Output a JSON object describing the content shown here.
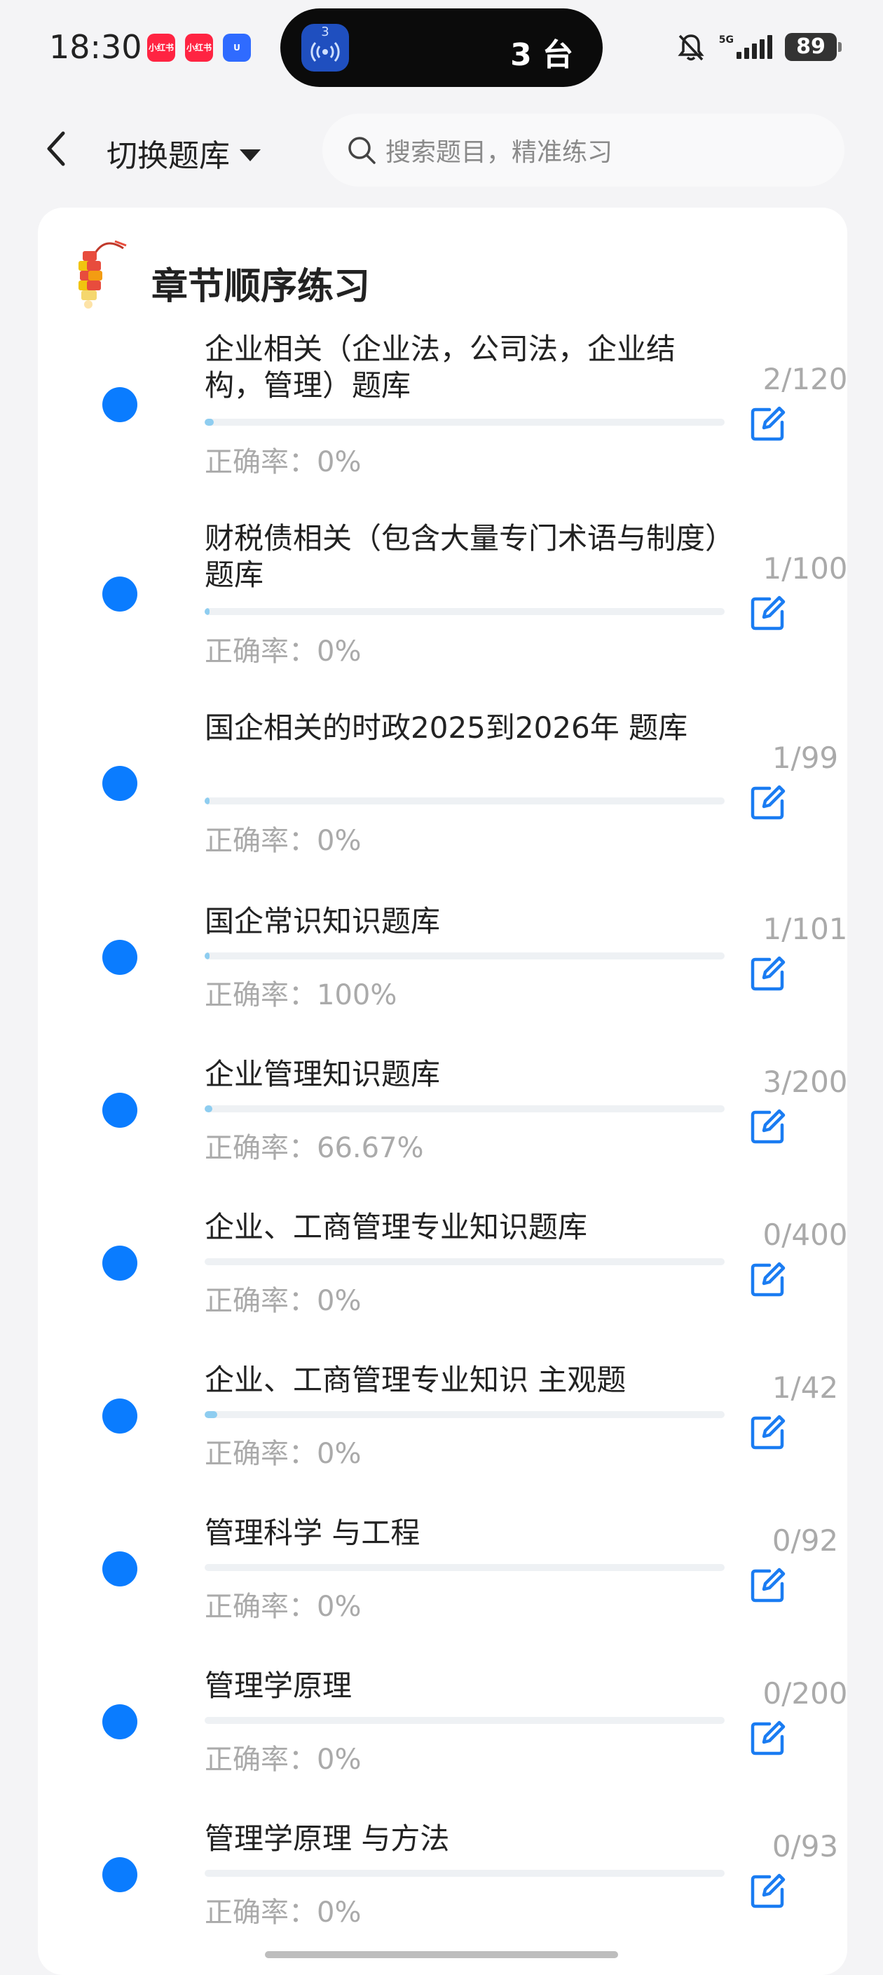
{
  "status_bar": {
    "time": "18:30",
    "app_icons": [
      "小红书",
      "小红书",
      "U"
    ],
    "island_badge": "3",
    "island_text": "3 台",
    "network": "5G",
    "battery": "89"
  },
  "header": {
    "switch_label": "切换题库",
    "search_placeholder": "搜索题目，精准练习"
  },
  "section": {
    "title": "章节顺序练习"
  },
  "accuracy_prefix": "正确率：",
  "items": [
    {
      "title": "企业相关（企业法，公司法，企业结构，管理）题库",
      "count": "2/120",
      "accuracy": "0%",
      "progress": 0.017
    },
    {
      "title": "财税债相关（包含大量专门术语与制度）题库",
      "count": "1/100",
      "accuracy": "0%",
      "progress": 0.01
    },
    {
      "title": "国企相关的时政2025到2026年 题库",
      "count": "1/99",
      "accuracy": "0%",
      "progress": 0.01
    },
    {
      "title": "国企常识知识题库",
      "count": "1/101",
      "accuracy": "100%",
      "progress": 0.01
    },
    {
      "title": "企业管理知识题库",
      "count": "3/200",
      "accuracy": "66.67%",
      "progress": 0.015
    },
    {
      "title": "企业、工商管理专业知识题库",
      "count": "0/400",
      "accuracy": "0%",
      "progress": 0
    },
    {
      "title": "企业、工商管理专业知识 主观题",
      "count": "1/42",
      "accuracy": "0%",
      "progress": 0.024
    },
    {
      "title": "管理科学 与工程",
      "count": "0/92",
      "accuracy": "0%",
      "progress": 0
    },
    {
      "title": "管理学原理",
      "count": "0/200",
      "accuracy": "0%",
      "progress": 0
    },
    {
      "title": "管理学原理 与方法",
      "count": "0/93",
      "accuracy": "0%",
      "progress": 0
    }
  ]
}
